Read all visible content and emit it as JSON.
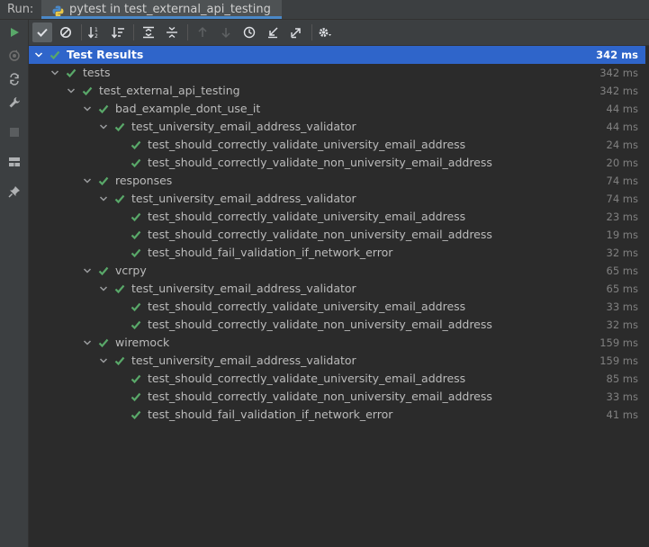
{
  "runbar": {
    "label": "Run:",
    "tab_title": "pytest in test_external_api_testing"
  },
  "colors": {
    "accent": "#2f65ca",
    "pass": "#59a869",
    "tab_underline": "#4a88c7"
  },
  "toolbar": {
    "icons": [
      "rerun-icon",
      "show-passed-icon",
      "show-ignored-icon",
      "sort-alpha-icon",
      "sort-duration-icon",
      "expand-all-icon",
      "collapse-all-icon",
      "prev-failed-icon",
      "next-failed-icon",
      "history-icon",
      "import-icon",
      "export-icon",
      "settings-icon"
    ]
  },
  "sidebar": {
    "icons": [
      "run-icon",
      "rerun-failed-icon",
      "toggle-auto-test-icon",
      "wrench-icon",
      "stop-icon",
      "layout-icon",
      "pin-icon"
    ]
  },
  "tree": {
    "rows": [
      {
        "name": "Test Results",
        "dur": "342 ms",
        "depth": 0,
        "expandable": true,
        "selected": true
      },
      {
        "name": "tests",
        "dur": "342 ms",
        "depth": 1,
        "expandable": true
      },
      {
        "name": "test_external_api_testing",
        "dur": "342 ms",
        "depth": 2,
        "expandable": true
      },
      {
        "name": "bad_example_dont_use_it",
        "dur": "44 ms",
        "depth": 3,
        "expandable": true
      },
      {
        "name": "test_university_email_address_validator",
        "dur": "44 ms",
        "depth": 4,
        "expandable": true
      },
      {
        "name": "test_should_correctly_validate_university_email_address",
        "dur": "24 ms",
        "depth": 5,
        "expandable": false
      },
      {
        "name": "test_should_correctly_validate_non_university_email_address",
        "dur": "20 ms",
        "depth": 5,
        "expandable": false
      },
      {
        "name": "responses",
        "dur": "74 ms",
        "depth": 3,
        "expandable": true
      },
      {
        "name": "test_university_email_address_validator",
        "dur": "74 ms",
        "depth": 4,
        "expandable": true
      },
      {
        "name": "test_should_correctly_validate_university_email_address",
        "dur": "23 ms",
        "depth": 5,
        "expandable": false
      },
      {
        "name": "test_should_correctly_validate_non_university_email_address",
        "dur": "19 ms",
        "depth": 5,
        "expandable": false
      },
      {
        "name": "test_should_fail_validation_if_network_error",
        "dur": "32 ms",
        "depth": 5,
        "expandable": false
      },
      {
        "name": "vcrpy",
        "dur": "65 ms",
        "depth": 3,
        "expandable": true
      },
      {
        "name": "test_university_email_address_validator",
        "dur": "65 ms",
        "depth": 4,
        "expandable": true
      },
      {
        "name": "test_should_correctly_validate_university_email_address",
        "dur": "33 ms",
        "depth": 5,
        "expandable": false
      },
      {
        "name": "test_should_correctly_validate_non_university_email_address",
        "dur": "32 ms",
        "depth": 5,
        "expandable": false
      },
      {
        "name": "wiremock",
        "dur": "159 ms",
        "depth": 3,
        "expandable": true
      },
      {
        "name": "test_university_email_address_validator",
        "dur": "159 ms",
        "depth": 4,
        "expandable": true
      },
      {
        "name": "test_should_correctly_validate_university_email_address",
        "dur": "85 ms",
        "depth": 5,
        "expandable": false
      },
      {
        "name": "test_should_correctly_validate_non_university_email_address",
        "dur": "33 ms",
        "depth": 5,
        "expandable": false
      },
      {
        "name": "test_should_fail_validation_if_network_error",
        "dur": "41 ms",
        "depth": 5,
        "expandable": false
      }
    ]
  }
}
